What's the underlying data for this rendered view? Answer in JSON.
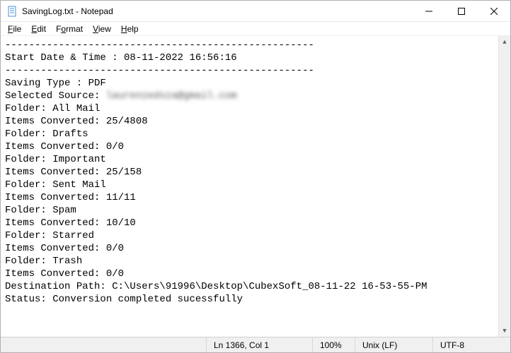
{
  "window": {
    "title": "SavingLog.txt - Notepad"
  },
  "menu": {
    "file": "File",
    "edit": "Edit",
    "format": "Format",
    "view": "View",
    "help": "Help"
  },
  "log": {
    "sep": "----------------------------------------------------",
    "start_line": "Start Date & Time : 08-11-2022 16:56:16",
    "saving_type": "Saving Type : PDF",
    "selected_source_label": "Selected Source: ",
    "selected_source_value": "laurenzedsza@gmail.com",
    "lines": [
      "Folder: All Mail",
      "Items Converted: 25/4808",
      "Folder: Drafts",
      "Items Converted: 0/0",
      "Folder: Important",
      "Items Converted: 25/158",
      "Folder: Sent Mail",
      "Items Converted: 11/11",
      "Folder: Spam",
      "Items Converted: 10/10",
      "Folder: Starred",
      "Items Converted: 0/0",
      "Folder: Trash",
      "Items Converted: 0/0"
    ],
    "destination": "Destination Path: C:\\Users\\91996\\Desktop\\CubexSoft_08-11-22 16-53-55-PM",
    "status": "Status: Conversion completed sucessfully"
  },
  "statusbar": {
    "position": "Ln 1366, Col 1",
    "zoom": "100%",
    "line_ending": "Unix (LF)",
    "encoding": "UTF-8"
  }
}
